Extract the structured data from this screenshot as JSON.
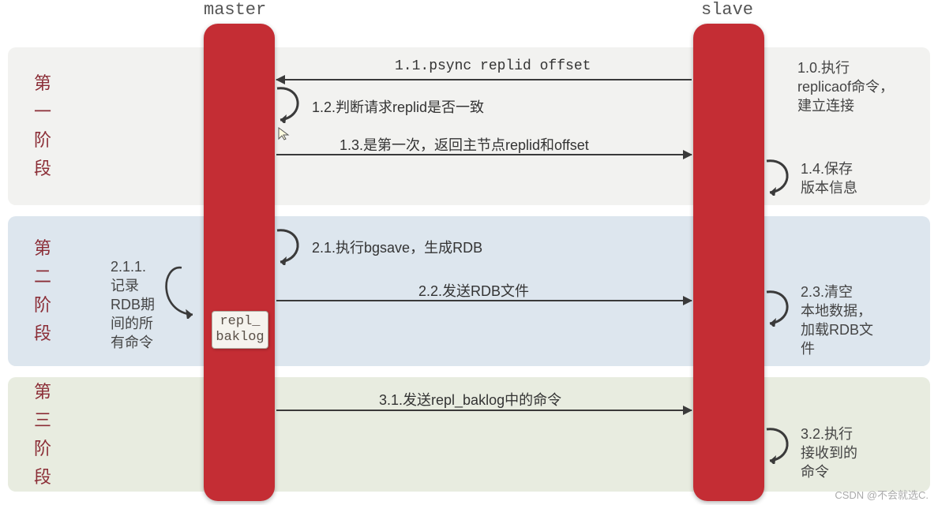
{
  "headers": {
    "master": "master",
    "slave": "slave"
  },
  "phases": {
    "p1": "第\n一\n阶\n段",
    "p2": "第\n二\n阶\n段",
    "p3": "第\n三\n阶\n段"
  },
  "msgs": {
    "m11": "1.1.psync replid offset",
    "m12": "1.2.判断请求replid是否一致",
    "m13": "1.3.是第一次，返回主节点replid和offset",
    "m21": "2.1.执行bgsave，生成RDB",
    "m22": "2.2.发送RDB文件",
    "m31": "3.1.发送repl_baklog中的命令"
  },
  "notes": {
    "n10": "1.0.执行\nreplicaof命令，\n建立连接",
    "n14": "1.4.保存\n版本信息",
    "n211": "2.1.1.\n记录\nRDB期\n间的所\n有命令",
    "n23": "2.3.清空\n本地数据，\n加载RDB文\n件",
    "n32": "3.2.执行\n接收到的\n命令"
  },
  "repl_box": "repl_\nbaklog",
  "watermark": "CSDN @不会就选C."
}
